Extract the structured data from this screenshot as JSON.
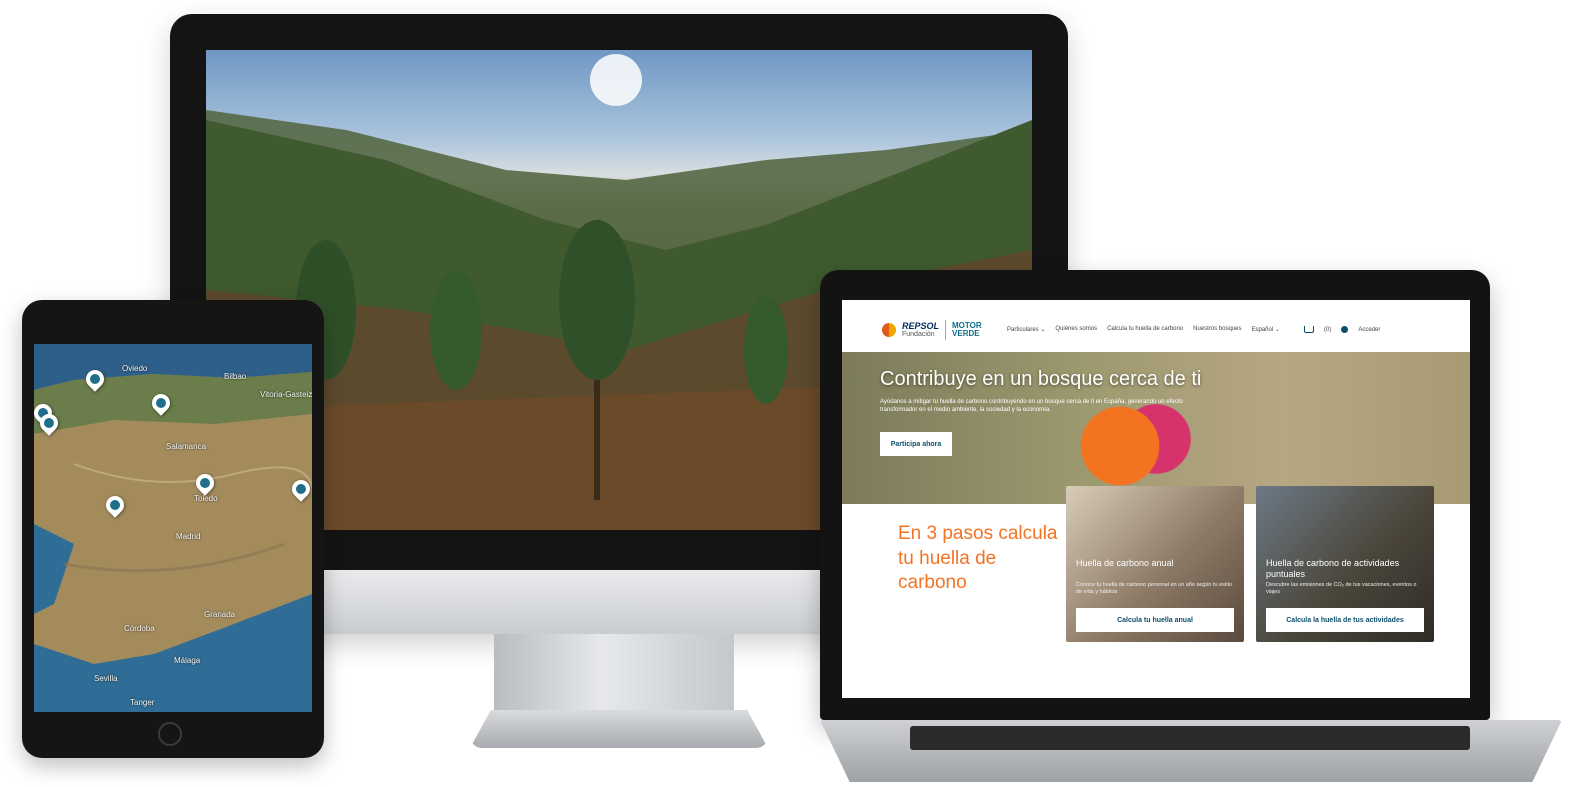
{
  "colors": {
    "accent_orange": "#f37321",
    "brand_blue": "#0b4f6c",
    "brand_teal": "#0b6f8a"
  },
  "tablet_map": {
    "labels": [
      "Oviedo",
      "Bilbao",
      "Vitoria-Gasteiz",
      "Salamanca",
      "Madrid",
      "Toledo",
      "Granada",
      "Málaga",
      "Córdoba",
      "Sevilla",
      "Tanger"
    ],
    "markers": [
      {
        "icon": "tree-marker-icon"
      },
      {
        "icon": "tree-marker-icon"
      },
      {
        "icon": "tree-marker-icon"
      },
      {
        "icon": "tree-marker-icon"
      },
      {
        "icon": "tree-marker-icon"
      },
      {
        "icon": "tree-marker-icon"
      },
      {
        "icon": "tree-marker-icon"
      }
    ]
  },
  "laptop": {
    "logo": {
      "brand": "REPSOL",
      "sub": "Fundación",
      "motor_line1": "MOTOR",
      "motor_line2": "VERDE"
    },
    "nav": {
      "links": [
        "Particulares ⌄",
        "Quiénes somos",
        "Calcula tu huella de carbono",
        "Nuestros bosques",
        "Español ⌄"
      ],
      "cart_count": "(0)",
      "user_label": "Acceder"
    },
    "hero": {
      "title": "Contribuye en un bosque cerca de ti",
      "text": "Ayúdanos a mitigar tu huella de carbono contribuyendo en un bosque cerca de ti en España, generando un efecto transformador en el medio ambiente, la sociedad y la economía.",
      "button": "Participa ahora"
    },
    "steps_title": "En 3 pasos calcula tu huella de carbono",
    "cards": [
      {
        "title": "Huella de carbono anual",
        "text": "Conoce tu huella de carbono personal en un año según tu estilo de vida y hábitos",
        "button": "Calcula tu huella anual"
      },
      {
        "title": "Huella de carbono de actividades puntuales",
        "text": "Descubre las emisiones de CO₂ de tus vacaciones, eventos o viajes",
        "button": "Calcula la huella de tus actividades"
      }
    ]
  }
}
